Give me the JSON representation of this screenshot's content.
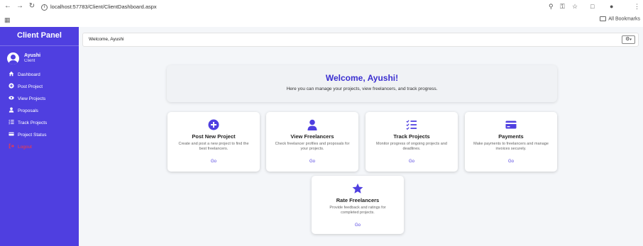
{
  "browser": {
    "url": "localhost:57783/Client/ClientDashboard.aspx",
    "bookmarks_label": "All Bookmarks"
  },
  "sidebar": {
    "title": "Client Panel",
    "user": {
      "name": "Ayushi",
      "role": "Client"
    },
    "items": [
      {
        "label": "Dashboard",
        "icon": "home-icon"
      },
      {
        "label": "Post Project",
        "icon": "plus-circle-icon"
      },
      {
        "label": "View Projects",
        "icon": "eye-icon"
      },
      {
        "label": "Proposals",
        "icon": "user-icon"
      },
      {
        "label": "Track Projects",
        "icon": "list-check-icon"
      },
      {
        "label": "Project Status",
        "icon": "card-icon"
      },
      {
        "label": "Logout",
        "icon": "logout-icon"
      }
    ]
  },
  "topbar": {
    "welcome": "Welcome, Ayushi"
  },
  "hero": {
    "title": "Welcome, Ayushi!",
    "subtitle": "Here you can manage your projects, view freelancers, and track progress."
  },
  "cards": [
    {
      "title": "Post New Project",
      "desc": "Create and post a new project to find the best freelancers.",
      "link": "Go",
      "icon": "plus-circle-icon"
    },
    {
      "title": "View Freelancers",
      "desc": "Check freelancer profiles and proposals for your projects.",
      "link": "Go",
      "icon": "user-icon"
    },
    {
      "title": "Track Projects",
      "desc": "Monitor progress of ongoing projects and deadlines.",
      "link": "Go",
      "icon": "list-check-icon"
    },
    {
      "title": "Payments",
      "desc": "Make payments to freelancers and manage invoices securely.",
      "link": "Go",
      "icon": "credit-card-icon"
    },
    {
      "title": "Rate Freelancers",
      "desc": "Provide feedback and ratings for completed projects.",
      "link": "Go",
      "icon": "star-icon"
    }
  ],
  "colors": {
    "sidebar": "#4f3fe0",
    "accent": "#3b2fd0",
    "logout": "#ff3a3a",
    "background": "#f4f6f9"
  }
}
